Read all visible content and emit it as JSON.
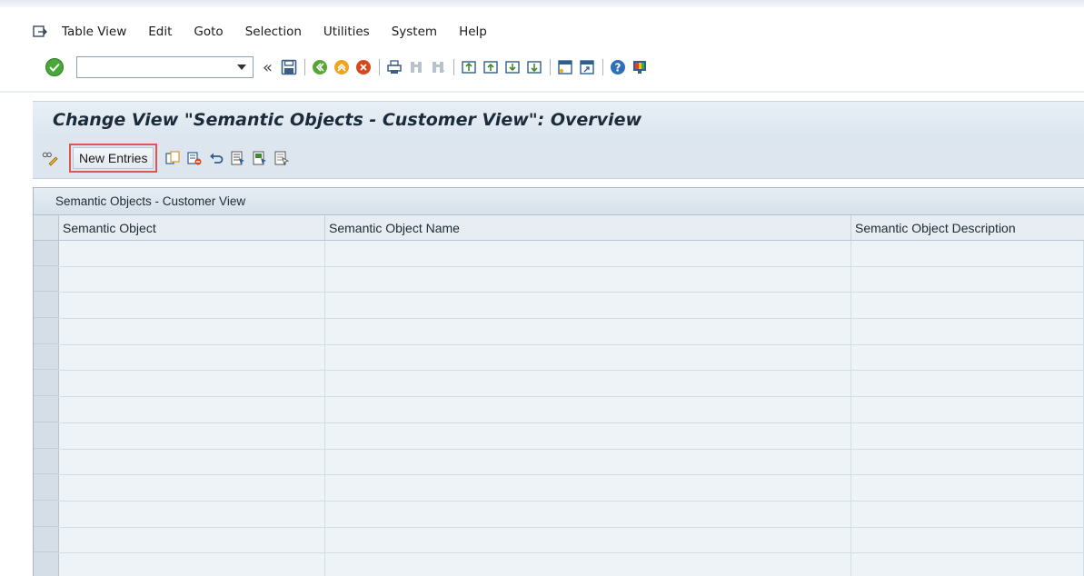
{
  "menu": {
    "items": [
      {
        "label": "Table View"
      },
      {
        "label": "Edit"
      },
      {
        "label": "Goto"
      },
      {
        "label": "Selection"
      },
      {
        "label": "Utilities"
      },
      {
        "label": "System"
      },
      {
        "label": "Help"
      }
    ]
  },
  "system_toolbar": {
    "command_field_value": "",
    "icons": [
      "enter-icon",
      "command-dropdown-icon",
      "collapse-icon",
      "save-icon",
      "back-icon",
      "exit-icon",
      "cancel-icon",
      "print-icon",
      "find-icon",
      "find-next-icon",
      "first-page-icon",
      "previous-page-icon",
      "next-page-icon",
      "last-page-icon",
      "create-session-icon",
      "shortcut-icon",
      "help-icon",
      "customize-layout-icon"
    ]
  },
  "title": "Change View \"Semantic Objects - Customer View\": Overview",
  "app_toolbar": {
    "new_entries_label": "New Entries",
    "icons": [
      "display-change-icon",
      "copy-as-icon",
      "delete-icon",
      "undo-change-icon",
      "select-all-icon",
      "select-block-icon",
      "deselect-all-icon"
    ]
  },
  "table": {
    "caption": "Semantic Objects - Customer View",
    "columns": [
      "Semantic Object",
      "Semantic Object Name",
      "Semantic Object Description"
    ],
    "rows": [
      [
        "",
        "",
        ""
      ],
      [
        "",
        "",
        ""
      ],
      [
        "",
        "",
        ""
      ],
      [
        "",
        "",
        ""
      ],
      [
        "",
        "",
        ""
      ],
      [
        "",
        "",
        ""
      ],
      [
        "",
        "",
        ""
      ],
      [
        "",
        "",
        ""
      ],
      [
        "",
        "",
        ""
      ],
      [
        "",
        "",
        ""
      ],
      [
        "",
        "",
        ""
      ],
      [
        "",
        "",
        ""
      ],
      [
        "",
        "",
        ""
      ]
    ]
  },
  "colors": {
    "accent_red": "#e05454",
    "ok_green": "#4aa83b",
    "title_bg": "#dce6ef"
  }
}
